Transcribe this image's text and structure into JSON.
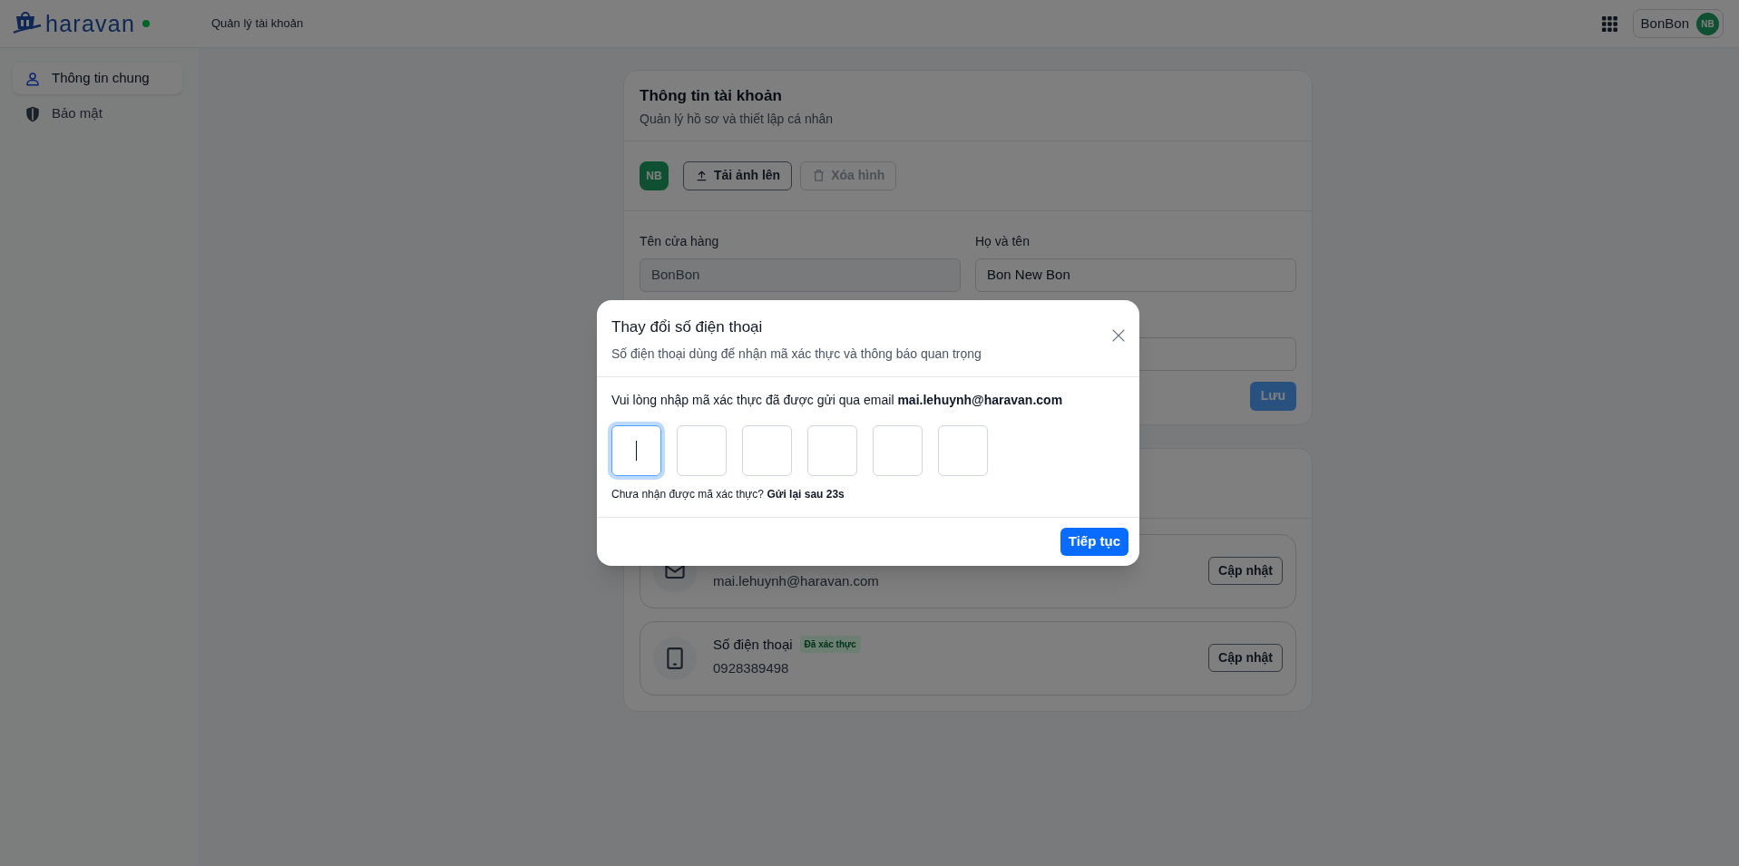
{
  "header": {
    "logo": "haravan",
    "online": true,
    "page_title": "Quản lý tài khoản",
    "user": {
      "name": "BonBon",
      "initials": "NB"
    }
  },
  "sidebar": {
    "items": [
      {
        "label": "Thông tin chung",
        "selected": true
      },
      {
        "label": "Bảo mật",
        "selected": false
      }
    ]
  },
  "account_card": {
    "title": "Thông tin tài khoản",
    "subtitle": "Quản lý hồ sơ và thiết lập cá nhân",
    "avatar": "NB",
    "avatar_buttons": [
      {
        "label": "Tải ảnh lên",
        "disabled": false
      },
      {
        "label": "Xóa hình",
        "disabled": true
      }
    ],
    "fields": [
      {
        "label": "Tên cửa hàng",
        "value": "BonBon",
        "disabled": true
      },
      {
        "label": "Họ và tên",
        "value": "Bon New Bon",
        "disabled": false
      }
    ],
    "save_button": "Lưu"
  },
  "contacts": [
    {
      "kind": "email",
      "value": "mai.lehuynh@haravan.com",
      "button": "Cập nhật"
    },
    {
      "kind": "phone",
      "title": "Số điện thoại",
      "badge": "Đã xác thực",
      "value": "0928389498",
      "button": "Cập nhật"
    }
  ],
  "modal": {
    "title": "Thay đổi số điện thoại",
    "subtitle": "Số điện thoại dùng để nhận mã xác thực và thông báo quan trọng",
    "instruction": "Vui lòng nhập mã xác thực đã được gửi qua email **mai.lehuynh@haravan.com**",
    "code_boxes": [
      {
        "focused": true
      },
      {
        "focused": false
      },
      {
        "focused": false
      },
      {
        "focused": false
      },
      {
        "focused": false
      },
      {
        "focused": false
      }
    ],
    "resend": "Chưa nhận được mã xác thực? **Gửi lại sau 23s**",
    "continue_button": "Tiếp tục"
  }
}
